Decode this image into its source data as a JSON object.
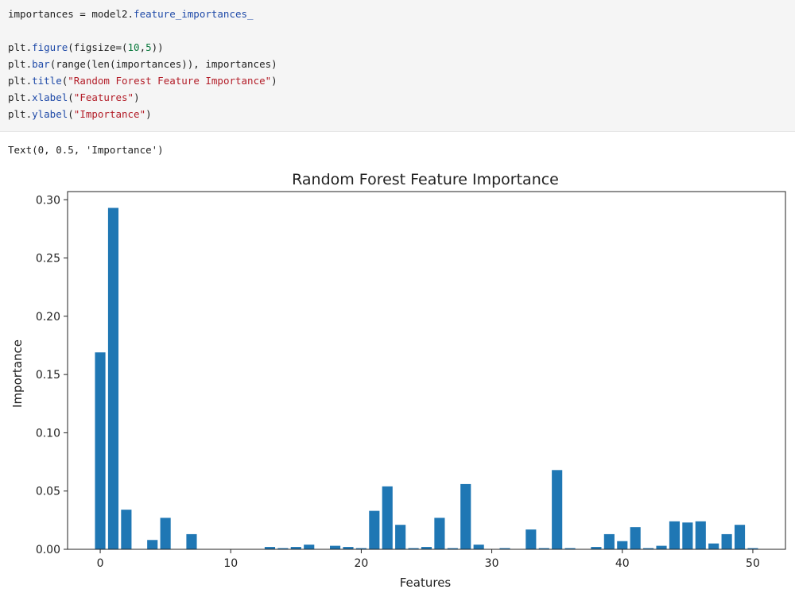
{
  "code_cell": {
    "lines": [
      [
        {
          "t": "importances = model2.",
          "c": ""
        },
        {
          "t": "feature_importances_",
          "c": "attr"
        }
      ],
      [],
      [
        {
          "t": "plt.",
          "c": ""
        },
        {
          "t": "figure",
          "c": "attr"
        },
        {
          "t": "(figsize=(",
          "c": ""
        },
        {
          "t": "10",
          "c": "num"
        },
        {
          "t": ",",
          "c": ""
        },
        {
          "t": "5",
          "c": "num"
        },
        {
          "t": "))",
          "c": ""
        }
      ],
      [
        {
          "t": "plt.",
          "c": ""
        },
        {
          "t": "bar",
          "c": "attr"
        },
        {
          "t": "(range(len(importances)), importances)",
          "c": ""
        }
      ],
      [
        {
          "t": "plt.",
          "c": ""
        },
        {
          "t": "title",
          "c": "attr"
        },
        {
          "t": "(",
          "c": ""
        },
        {
          "t": "\"Random Forest Feature Importance\"",
          "c": "str"
        },
        {
          "t": ")",
          "c": ""
        }
      ],
      [
        {
          "t": "plt.",
          "c": ""
        },
        {
          "t": "xlabel",
          "c": "attr"
        },
        {
          "t": "(",
          "c": ""
        },
        {
          "t": "\"Features\"",
          "c": "str"
        },
        {
          "t": ")",
          "c": ""
        }
      ],
      [
        {
          "t": "plt.",
          "c": ""
        },
        {
          "t": "ylabel",
          "c": "attr"
        },
        {
          "t": "(",
          "c": ""
        },
        {
          "t": "\"Importance\"",
          "c": "str"
        },
        {
          "t": ")",
          "c": ""
        }
      ]
    ]
  },
  "output_text": "Text(0, 0.5, 'Importance')",
  "chart_data": {
    "type": "bar",
    "title": "Random Forest Feature Importance",
    "xlabel": "Features",
    "ylabel": "Importance",
    "x": [
      0,
      1,
      2,
      3,
      4,
      5,
      6,
      7,
      8,
      9,
      10,
      11,
      12,
      13,
      14,
      15,
      16,
      17,
      18,
      19,
      20,
      21,
      22,
      23,
      24,
      25,
      26,
      27,
      28,
      29,
      30,
      31,
      32,
      33,
      34,
      35,
      36,
      37,
      38,
      39,
      40,
      41,
      42,
      43,
      44,
      45,
      46,
      47,
      48,
      49,
      50
    ],
    "values": [
      0.169,
      0.293,
      0.034,
      0.0,
      0.008,
      0.027,
      0.0,
      0.013,
      0.0,
      0.0,
      0.0,
      0.0,
      0.0,
      0.002,
      0.001,
      0.002,
      0.004,
      0.0,
      0.003,
      0.002,
      0.001,
      0.033,
      0.054,
      0.021,
      0.001,
      0.002,
      0.027,
      0.001,
      0.056,
      0.004,
      0.0,
      0.001,
      0.0,
      0.017,
      0.001,
      0.068,
      0.001,
      0.0,
      0.002,
      0.013,
      0.007,
      0.019,
      0.001,
      0.003,
      0.024,
      0.023,
      0.024,
      0.005,
      0.013,
      0.021,
      0.001
    ],
    "xlim": [
      -2.5,
      52.5
    ],
    "ylim": [
      0,
      0.307
    ],
    "xticks": [
      0,
      10,
      20,
      30,
      40,
      50
    ],
    "yticks": [
      0.0,
      0.05,
      0.1,
      0.15,
      0.2,
      0.25,
      0.3
    ],
    "ytick_labels": [
      "0.00",
      "0.05",
      "0.10",
      "0.15",
      "0.20",
      "0.25",
      "0.30"
    ],
    "grid": false,
    "bar_color": "#1f77b4"
  }
}
